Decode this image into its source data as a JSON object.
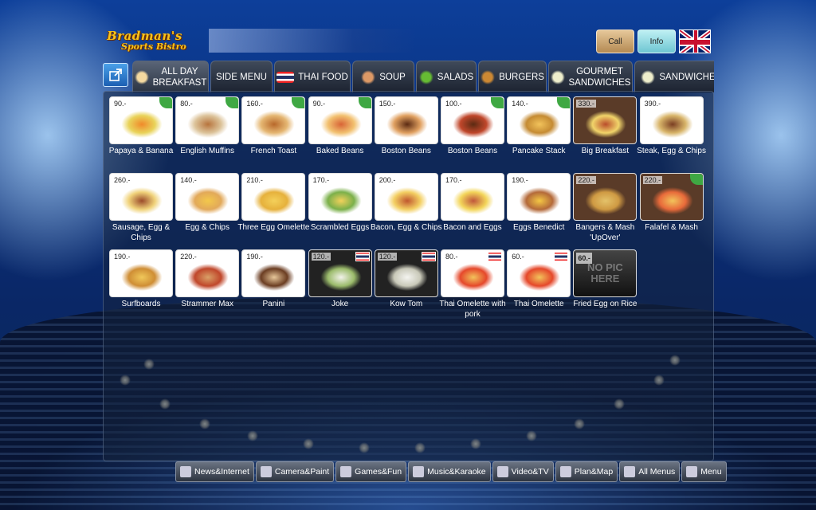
{
  "brand": {
    "line1": "Bradman's",
    "line2": "Sports Bistro"
  },
  "top_buttons": {
    "call": "Call",
    "info": "Info"
  },
  "tabs": [
    {
      "label": "ALL DAY\nBREAKFAST",
      "icon": "coffee-cup-icon"
    },
    {
      "label": "SIDE MENU",
      "icon": ""
    },
    {
      "label": "THAI FOOD",
      "icon": "thai-flag-icon"
    },
    {
      "label": "SOUP",
      "icon": "soup-bowl-icon"
    },
    {
      "label": "SALADS",
      "icon": "salad-icon"
    },
    {
      "label": "BURGERS",
      "icon": "burger-icon"
    },
    {
      "label": "GOURMET\nSANDWICHES",
      "icon": "sandwich-icon"
    },
    {
      "label": "SANDWICHE",
      "icon": "sandwich-icon"
    }
  ],
  "menu_items": [
    {
      "name": "Papaya & Banana",
      "price": "90.-"
    },
    {
      "name": "English Muffins",
      "price": "80.-"
    },
    {
      "name": "French Toast",
      "price": "160.-"
    },
    {
      "name": "Baked Beans",
      "price": "90.-"
    },
    {
      "name": "Boston Beans",
      "price": "150.-"
    },
    {
      "name": "Boston Beans",
      "price": "100.-"
    },
    {
      "name": "Pancake Stack",
      "price": "140.-"
    },
    {
      "name": "Big Breakfast",
      "price": "330.-"
    },
    {
      "name": "Steak, Egg & Chips",
      "price": "390.-"
    },
    {
      "name": "Sausage, Egg & Chips",
      "price": "260.-"
    },
    {
      "name": "Egg & Chips",
      "price": "140.-"
    },
    {
      "name": "Three Egg Omelette",
      "price": "210.-"
    },
    {
      "name": "Scrambled Eggs",
      "price": "170.-"
    },
    {
      "name": "Bacon, Egg & Chips",
      "price": "200.-"
    },
    {
      "name": "Bacon and Eggs",
      "price": "170.-"
    },
    {
      "name": "Eggs Benedict",
      "price": "190.-"
    },
    {
      "name": "Bangers & Mash 'UpOver'",
      "price": "220.-"
    },
    {
      "name": "Falafel & Mash",
      "price": "220.-"
    },
    {
      "name": "Surfboards",
      "price": "190.-"
    },
    {
      "name": "Strammer Max",
      "price": "220.-"
    },
    {
      "name": "Panini",
      "price": "190.-"
    },
    {
      "name": "Joke",
      "price": "120.-"
    },
    {
      "name": "Kow Tom",
      "price": "120.-"
    },
    {
      "name": "Thai Omelette with pork",
      "price": "80.-"
    },
    {
      "name": "Thai Omelette",
      "price": "60.-"
    },
    {
      "name": "Fried Egg on Rice",
      "price": "60.-",
      "placeholder_text": "NO PIC HERE"
    }
  ],
  "bottom_nav": [
    {
      "label": "News&Internet",
      "icon": "phone-icon"
    },
    {
      "label": "Camera&Paint",
      "icon": "camera-icon"
    },
    {
      "label": "Games&Fun",
      "icon": "gamepad-icon"
    },
    {
      "label": "Music&Karaoke",
      "icon": "speaker-icon"
    },
    {
      "label": "Video&TV",
      "icon": "eye-icon"
    },
    {
      "label": "Plan&Map",
      "icon": "globe-icon"
    },
    {
      "label": "All Menus",
      "icon": "cart-icon"
    },
    {
      "label": "Menu",
      "icon": "fork-knife-icon"
    }
  ],
  "colors": {
    "accent_gold": "#f6c21c",
    "panel_bg": "#14233c",
    "leaf_green": "#3fa843"
  }
}
